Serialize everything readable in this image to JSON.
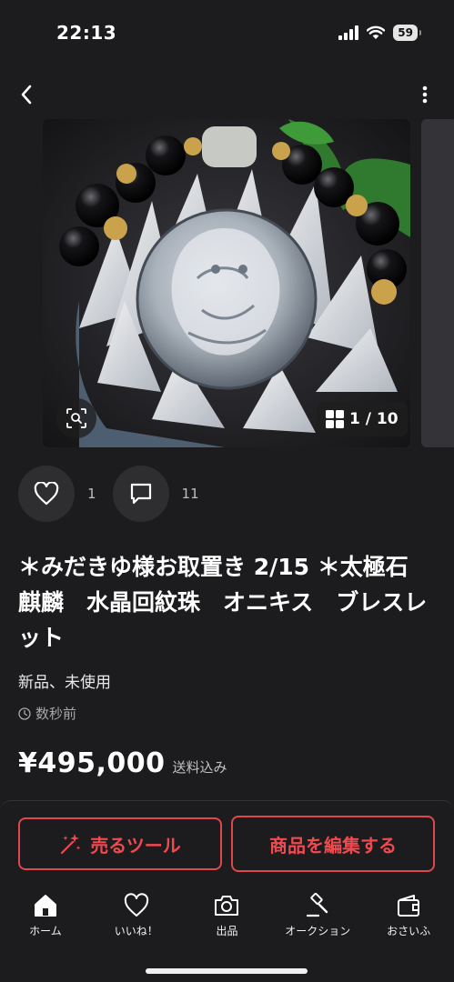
{
  "status": {
    "time": "22:13",
    "battery": "59"
  },
  "gallery": {
    "counter": "1 / 10"
  },
  "actions": {
    "like_count": "1",
    "comment_count": "11"
  },
  "item": {
    "title": "＊みだきゆ様お取置き 2/15 ＊太極石　麒麟　水晶回紋珠　オニキス　ブレスレット",
    "condition": "新品、未使用",
    "posted": "数秒前",
    "price": "¥495,000",
    "shipping": "送料込み"
  },
  "buttons": {
    "sell_tool": "売るツール",
    "edit_item": "商品を編集する"
  },
  "tabs": [
    {
      "label": "ホーム",
      "icon": "home-icon"
    },
    {
      "label": "いいね！",
      "icon": "heart-icon"
    },
    {
      "label": "出品",
      "icon": "camera-icon"
    },
    {
      "label": "オークション",
      "icon": "gavel-icon"
    },
    {
      "label": "おさいふ",
      "icon": "wallet-icon"
    }
  ],
  "colors": {
    "accent": "#ee4a50",
    "background": "#1c1c1e"
  }
}
